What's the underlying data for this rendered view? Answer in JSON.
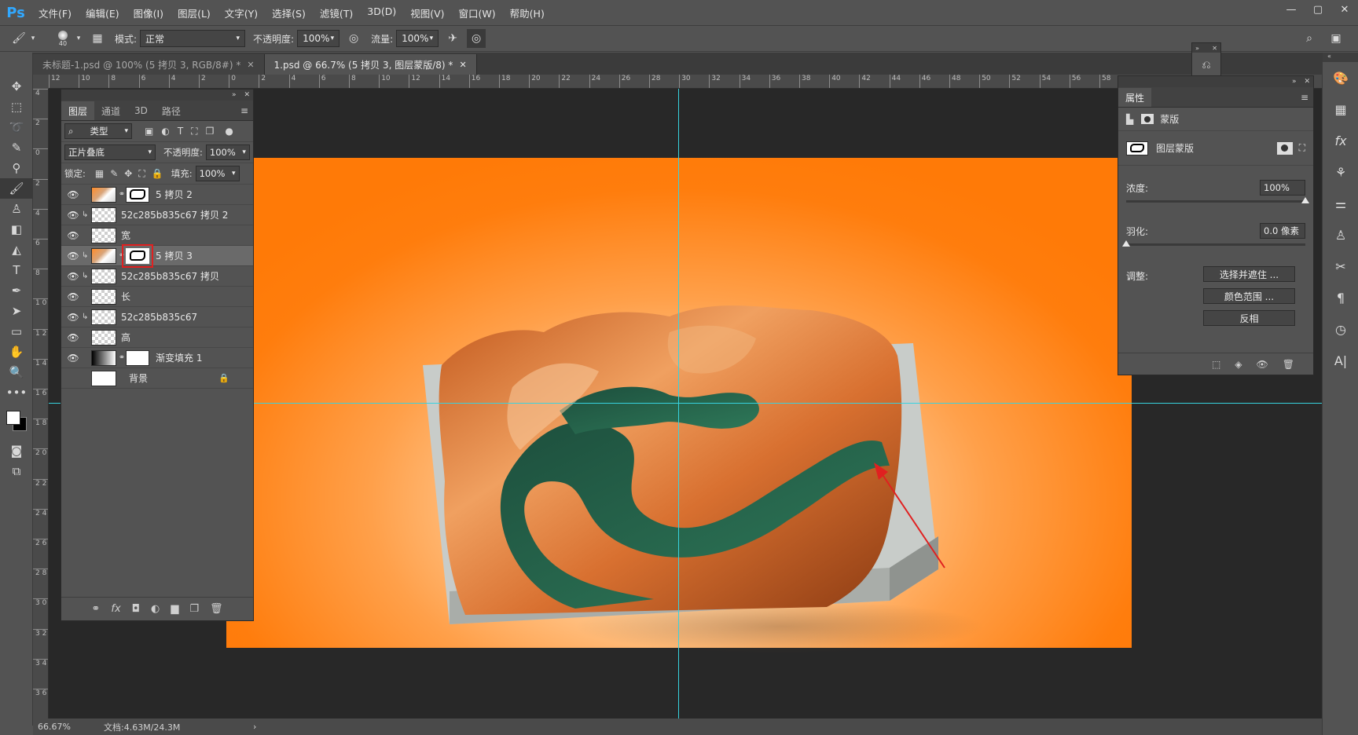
{
  "app": {
    "logo": "Ps",
    "menus": [
      "文件(F)",
      "编辑(E)",
      "图像(I)",
      "图层(L)",
      "文字(Y)",
      "选择(S)",
      "滤镜(T)",
      "3D(D)",
      "视图(V)",
      "窗口(W)",
      "帮助(H)"
    ],
    "window_controls": [
      "—",
      "▢",
      "✕"
    ]
  },
  "options": {
    "brush_size": "40",
    "mode_label": "模式:",
    "mode_value": "正常",
    "opacity_label": "不透明度:",
    "opacity_value": "100%",
    "flow_label": "流量:",
    "flow_value": "100%"
  },
  "tabs": [
    {
      "title": "未标题-1.psd @ 100% (5 拷贝 3, RGB/8#) *",
      "close": "✕"
    },
    {
      "title": "1.psd @ 66.7% (5 拷贝 3, 图层蒙版/8) *",
      "close": "✕"
    }
  ],
  "ruler": {
    "top": [
      "12",
      "10",
      "8",
      "6",
      "4",
      "2",
      "0",
      "2",
      "4",
      "6",
      "8",
      "10",
      "12",
      "14",
      "16",
      "18",
      "20",
      "22",
      "24",
      "26",
      "28",
      "30",
      "32",
      "34",
      "36",
      "38",
      "40",
      "42",
      "44",
      "46",
      "48",
      "50",
      "52",
      "54",
      "56",
      "58"
    ],
    "left": [
      "4",
      "2",
      "0",
      "2",
      "4",
      "6",
      "8",
      "1 0",
      "1 2",
      "1 4",
      "1 6",
      "1 8",
      "2 0",
      "2 2",
      "2 4",
      "2 6",
      "2 8",
      "3 0",
      "3 2",
      "3 4",
      "3 6"
    ]
  },
  "status": {
    "zoom": "66.67%",
    "doc": "文档:4.63M/24.3M",
    "arrow": "›"
  },
  "layers_panel": {
    "tabs": [
      "图层",
      "通道",
      "3D",
      "路径"
    ],
    "filter_label": "类型",
    "blend_mode": "正片叠底",
    "opacity_label": "不透明度:",
    "opacity_value": "100%",
    "lock_label": "锁定:",
    "fill_label": "填充:",
    "fill_value": "100%",
    "layers": [
      {
        "name": "5 拷贝 2"
      },
      {
        "name": "52c285b835c67 拷贝 2"
      },
      {
        "name": "宽"
      },
      {
        "name": "5 拷贝 3"
      },
      {
        "name": "52c285b835c67 拷贝"
      },
      {
        "name": "长"
      },
      {
        "name": "52c285b835c67"
      },
      {
        "name": "高"
      },
      {
        "name": "渐变填充 1"
      },
      {
        "name": "背景"
      }
    ],
    "bottom_icons": [
      "⚭",
      "fx",
      "◘",
      "◐",
      "▆",
      "❐",
      "🗑"
    ]
  },
  "props_panel": {
    "title": "属性",
    "section": "蒙版",
    "mask_label": "图层蒙版",
    "density_label": "浓度:",
    "density_value": "100%",
    "feather_label": "羽化:",
    "feather_value": "0.0 像素",
    "adjust_label": "调整:",
    "btn_select": "选择并遮住 ...",
    "btn_color_range": "颜色范围 ...",
    "btn_invert": "反相"
  },
  "colors": {
    "accent": "#31a8ff",
    "guide": "#37d3e0",
    "artboard_edge": "#ff7a07",
    "annotation": "#e02020"
  }
}
